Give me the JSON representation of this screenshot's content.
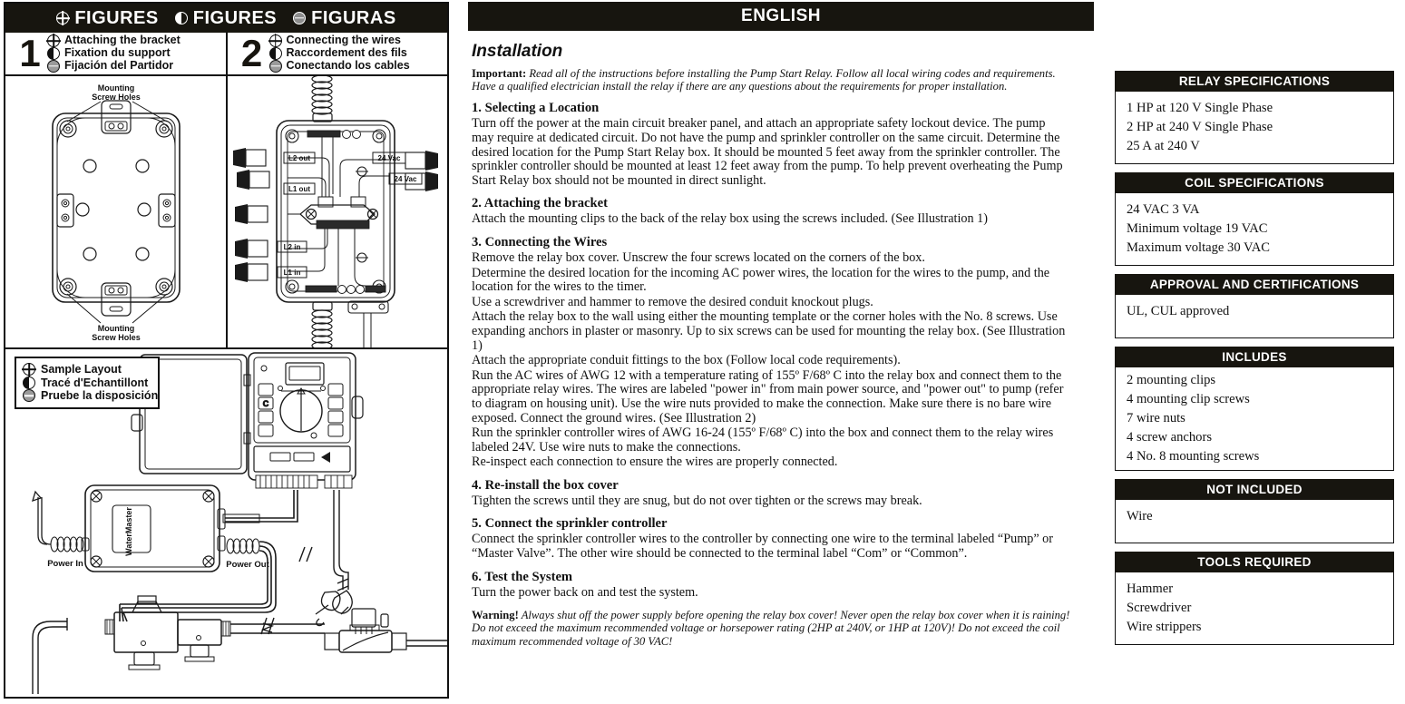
{
  "figures_panel": {
    "header": [
      {
        "icon": "globe-icon-english",
        "label": "FIGURES"
      },
      {
        "icon": "globe-icon-french",
        "label": "FIGURES"
      },
      {
        "icon": "globe-icon-spanish",
        "label": "FIGURAS"
      }
    ],
    "figure1": {
      "number": "1",
      "titles": [
        "Attaching the bracket",
        "Fixation du support",
        "Fijación del Partidor"
      ],
      "callout_top": "Mounting\nScrew Holes",
      "callout_top_line1": "Mounting",
      "callout_top_line2": "Screw Holes",
      "callout_bottom_line1": "Mounting",
      "callout_bottom_line2": "Screw Holes"
    },
    "figure2": {
      "number": "2",
      "titles": [
        "Connecting the wires",
        "Raccordement des fils",
        "Conectando los cables"
      ],
      "wire_labels": [
        "L2 out",
        "L1 out",
        "L2 in",
        "L1 in",
        "24 Vac",
        "24 Vac"
      ]
    },
    "sample_layout": {
      "titles": [
        "Sample Layout",
        "Tracé d'Echantillont",
        "Pruebe la disposición"
      ],
      "labels": [
        "Power In",
        "Power Out"
      ],
      "brand": "WaterMaster"
    }
  },
  "content": {
    "language_bar": "ENGLISH",
    "title": "Installation",
    "important_label": "Important:",
    "important_text": " Read all of the instructions before installing the Pump Start Relay. Follow all local wiring codes and requirements. Have a qualified electrician install the relay if there are any questions about the requirements for proper installation.",
    "sections": [
      {
        "heading": "1. Selecting a Location",
        "paragraphs": [
          "Turn off the power at the main circuit breaker panel, and attach an appropriate safety lockout device. The pump may require at dedicated circuit. Do not have the pump and sprinkler controller on the same circuit. Determine the desired location for the Pump Start Relay box.  It should be mounted 5 feet away from the sprinkler controller.  The sprinkler controller should be mounted at least 12 feet away from the pump.  To help prevent overheating the Pump Start Relay box should not be mounted in direct sunlight."
        ]
      },
      {
        "heading": "2. Attaching the bracket",
        "paragraphs": [
          "Attach the mounting clips to the back of the relay box using the screws included. (See Illustration 1)"
        ]
      },
      {
        "heading": "3. Connecting the Wires",
        "paragraphs": [
          "Remove the relay box cover.  Unscrew the four screws located on the corners of the box.",
          "Determine the desired location for the incoming AC power wires, the location for the wires to the pump, and the location for the wires to the timer.",
          "Use a screwdriver and hammer to remove the desired conduit knockout plugs.",
          "Attach the relay box to the wall using either the mounting template or the corner holes with the No. 8 screws. Use expanding anchors in plaster or masonry. Up to six screws can be used for mounting the relay box. (See Illustration 1)",
          "Attach the appropriate conduit fittings to the box (Follow local code requirements).",
          "Run the AC wires of AWG 12 with a temperature rating of 155º F/68º C into the relay box and connect them to the appropriate relay wires.  The wires are labeled \"power in\" from main power source, and \"power out\" to pump (refer to diagram on housing unit).  Use the wire nuts provided to make the connection.  Make sure there is no bare wire exposed.  Connect the ground wires. (See Illustration 2)",
          "Run the sprinkler controller wires of AWG 16-24 (155º F/68º C) into the box and connect them to the relay wires labeled 24V.  Use wire nuts to make the connections.",
          "Re-inspect each connection to ensure the wires are properly connected."
        ]
      },
      {
        "heading": "4. Re-install the box cover",
        "paragraphs": [
          "Tighten the screws until they are snug, but do not over tighten or the screws may break."
        ]
      },
      {
        "heading": "5. Connect the sprinkler controller",
        "paragraphs": [
          "Connect the sprinkler controller wires to the controller by connecting one wire to the terminal labeled “Pump” or “Master Valve”.  The other wire should be connected to the terminal label “Com” or “Common”."
        ]
      },
      {
        "heading": "6. Test the System",
        "paragraphs": [
          "Turn the power back on and test the system."
        ]
      }
    ],
    "warning_label": "Warning!",
    "warning_text": " Always shut off the power supply before opening the relay box cover! Never open the relay box cover when it is raining! Do not exceed the maximum recommended voltage or horsepower rating (2HP at 240V, or 1HP at 120V)! Do not exceed the coil maximum recommended voltage of 30 VAC!"
  },
  "specs": [
    {
      "title": "RELAY SPECIFICATIONS",
      "items": [
        "1 HP at 120 V Single Phase",
        "2 HP at 240 V Single Phase",
        "25 A at 240 V"
      ]
    },
    {
      "title": "COIL SPECIFICATIONS",
      "items": [
        "24 VAC 3 VA",
        "Minimum voltage 19 VAC",
        "Maximum voltage 30 VAC"
      ]
    },
    {
      "title": "APPROVAL AND CERTIFICATIONS",
      "items": [
        "UL, CUL approved"
      ]
    },
    {
      "title": "INCLUDES",
      "items": [
        "2 mounting clips",
        "4 mounting clip screws",
        "7 wire nuts",
        "4 screw anchors",
        "4 No. 8 mounting screws"
      ]
    },
    {
      "title": "NOT INCLUDED",
      "items": [
        "Wire"
      ]
    },
    {
      "title": "TOOLS REQUIRED",
      "items": [
        "Hammer",
        "Screwdriver",
        "Wire strippers"
      ]
    }
  ],
  "colors": {
    "ink": "#17150f",
    "paper": "#ffffff"
  }
}
